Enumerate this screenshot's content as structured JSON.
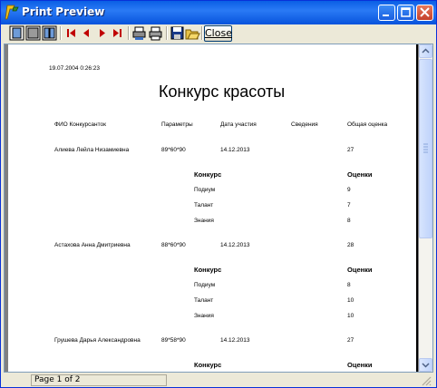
{
  "window": {
    "title": "Print Preview"
  },
  "toolbar": {
    "buttons": [
      "whole-page-icon",
      "page-width-icon",
      "two-pages-icon",
      "first-page-icon",
      "prev-page-icon",
      "next-page-icon",
      "last-page-icon",
      "page-setup-icon",
      "print-icon",
      "save-icon",
      "open-icon"
    ],
    "close_label": "Close"
  },
  "report": {
    "date": "19.07.2004 0:26:23",
    "title": "Конкурс красоты",
    "headers": {
      "name": "ФИО Конкурсанток",
      "params": "Параметры",
      "date": "Дата участия",
      "info": "Сведения",
      "total": "Общая оценка"
    },
    "contestants": [
      {
        "name": "Алиева Лейла Низамиевна",
        "params": "89*60*90",
        "date": "14.12.2013",
        "total": "27",
        "sub_header": {
          "contest": "Конкурс",
          "scores": "Оценки"
        },
        "items": [
          {
            "contest": "Подиум",
            "score": "9"
          },
          {
            "contest": "Талант",
            "score": "7"
          },
          {
            "contest": "Знания",
            "score": "8"
          }
        ]
      },
      {
        "name": "Астахова Анна Дмитриевна",
        "params": "88*60*90",
        "date": "14.12.2013",
        "total": "28",
        "sub_header": {
          "contest": "Конкурс",
          "scores": "Оценки"
        },
        "items": [
          {
            "contest": "Подиум",
            "score": "8"
          },
          {
            "contest": "Талант",
            "score": "10"
          },
          {
            "contest": "Знания",
            "score": "10"
          }
        ]
      },
      {
        "name": "Грушева Дарья Александровна",
        "params": "89*58*90",
        "date": "14.12.2013",
        "total": "27",
        "sub_header": {
          "contest": "Конкурс",
          "scores": "Оценки"
        },
        "items": []
      }
    ]
  },
  "status": {
    "page_label": "Page 1 of 2"
  },
  "colors": {
    "titlebar": "#0a5fe5",
    "page": "#ffffff",
    "workspace": "#808080"
  }
}
